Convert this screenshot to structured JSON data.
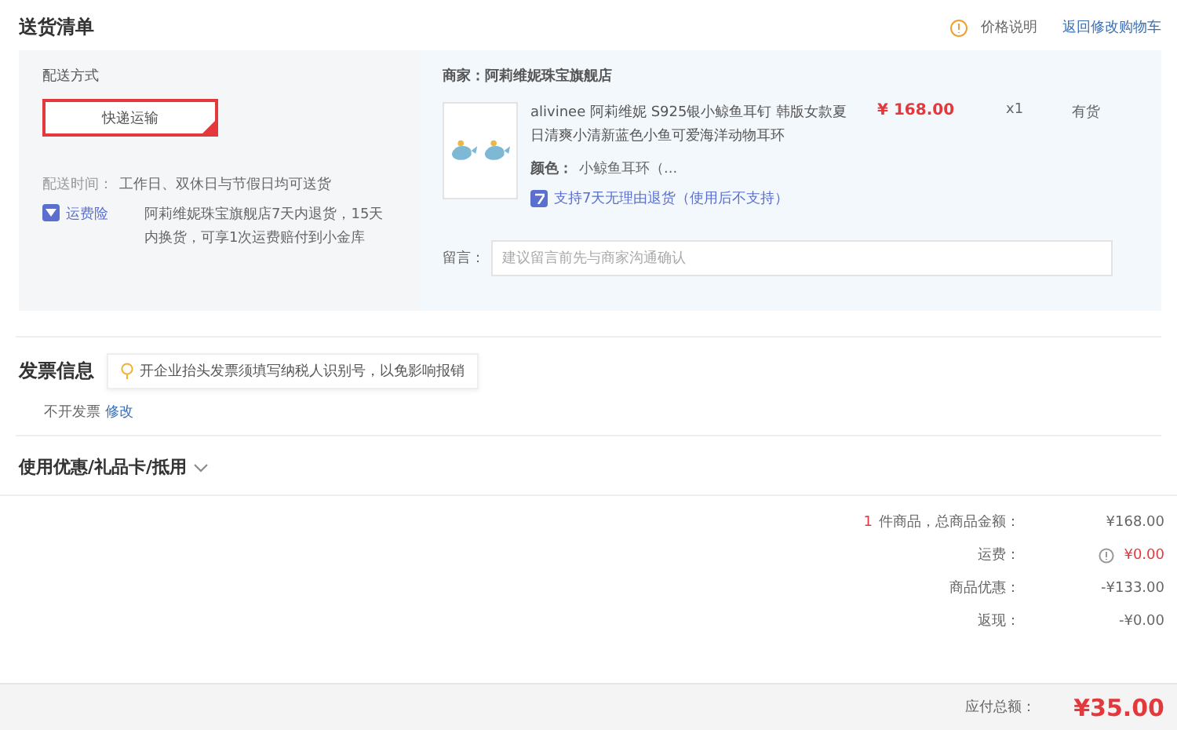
{
  "section_title": "送货清单",
  "header_links": [
    {
      "kind": "info",
      "label": "价格说明"
    },
    {
      "kind": "plain",
      "label": "返回修改购物车"
    }
  ],
  "shipping": {
    "label": "配送方式",
    "method": {
      "label": "快递运输",
      "selected": true
    },
    "time_label": "配送时间：",
    "time_value": "工作日、双休日与节假日均可送货",
    "insurance_label": "运费险",
    "insurance_text": "阿莉维妮珠宝旗舰店7天内退货，15天内换货，可享1次运费赔付到小金库"
  },
  "store": {
    "name": "商家：阿莉维妮珠宝旗舰店",
    "product": {
      "title": "alivinee 阿莉维妮 S925银小鲸鱼耳钉 韩版女款夏日清爽小清新蓝色小鱼可爱海洋动物耳环",
      "color_label": "颜色：",
      "color_value": "小鲸鱼耳环（...",
      "price": "¥ 168.00",
      "quantity": "x1",
      "stock": "有货",
      "return_policy": "支持7天无理由退货（使用后不支持）"
    },
    "note_label": "留言：",
    "note_placeholder": "建议留言前先与商家沟通确认"
  },
  "invoice": {
    "title": "发票信息",
    "tip": "开企业抬头发票须填写纳税人识别号，以免影响报销",
    "value": "不开发票",
    "edit_link": "修改"
  },
  "coupons": {
    "title": "使用优惠/礼品卡/抵用",
    "expanded": false
  },
  "summary": [
    {
      "kind": "count",
      "count": "1",
      "label": "件商品，总商品金额：",
      "value": "¥168.00"
    },
    {
      "kind": "fee",
      "label": "运费：",
      "value": "¥0.00"
    },
    {
      "kind": "plain",
      "label": "商品优惠：",
      "value": "-¥133.00"
    },
    {
      "kind": "plain",
      "label": "返现：",
      "value": "-¥0.00"
    }
  ],
  "total": {
    "label": "应付总额：",
    "value": "¥35.00"
  }
}
